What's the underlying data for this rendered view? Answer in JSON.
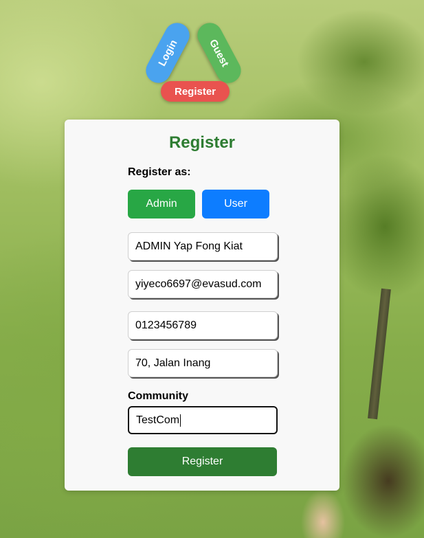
{
  "nav": {
    "login_label": "Login",
    "guest_label": "Guest",
    "register_label": "Register"
  },
  "form": {
    "title": "Register",
    "register_as_label": "Register as:",
    "roles": {
      "admin_label": "Admin",
      "user_label": "User"
    },
    "fields": {
      "name_value": "ADMIN Yap Fong Kiat",
      "email_value": "yiyeco6697@evasud.com",
      "phone_value": "0123456789",
      "address_value": "70, Jalan Inang"
    },
    "community_label": "Community",
    "community_value": "TestCom",
    "submit_label": "Register"
  },
  "colors": {
    "title_green": "#2e7d32",
    "admin_green": "#28a745",
    "user_blue": "#0d7dff",
    "login_blue": "#4aa3ef",
    "guest_green": "#5cb85c",
    "register_red": "#e9534f"
  }
}
